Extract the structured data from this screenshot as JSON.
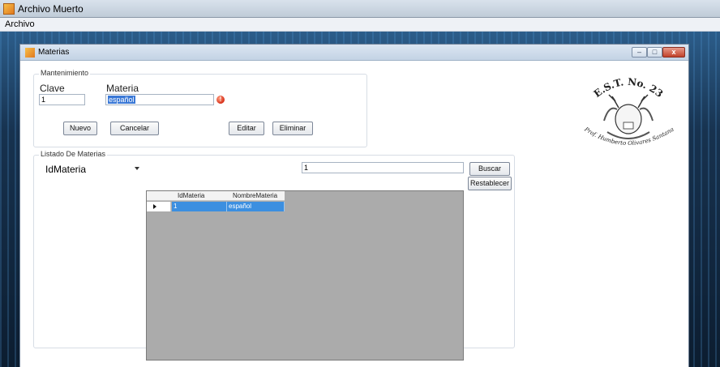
{
  "app": {
    "title": "Archivo Muerto"
  },
  "menubar": {
    "items": [
      "Archivo"
    ]
  },
  "child_window": {
    "title": "Materias",
    "controls": {
      "minimize": "–",
      "maximize": "□",
      "close": "x"
    }
  },
  "mantenimiento": {
    "legend": "Mantenimiento",
    "clave_label": "Clave",
    "materia_label": "Materia",
    "clave_value": "1",
    "materia_value": "español",
    "error_icon": "!",
    "buttons": {
      "nuevo": "Nuevo",
      "cancelar": "Cancelar",
      "editar": "Editar",
      "eliminar": "Eliminar"
    }
  },
  "listado": {
    "legend": "Listado De Materias",
    "filter_field_selected": "IdMateria",
    "search_value": "1",
    "buttons": {
      "buscar": "Buscar",
      "restablecer": "Restablecer"
    },
    "grid": {
      "columns": [
        "IdMateria",
        "NombreMateria"
      ],
      "rows": [
        [
          "1",
          "español"
        ]
      ]
    }
  },
  "emblem": {
    "top_text": "E.S.T. No. 23",
    "bottom_text": "Prof. Humberto Olivares Santana"
  },
  "colors": {
    "selection": "#3c8fe0",
    "grid_bg": "#ababab"
  }
}
